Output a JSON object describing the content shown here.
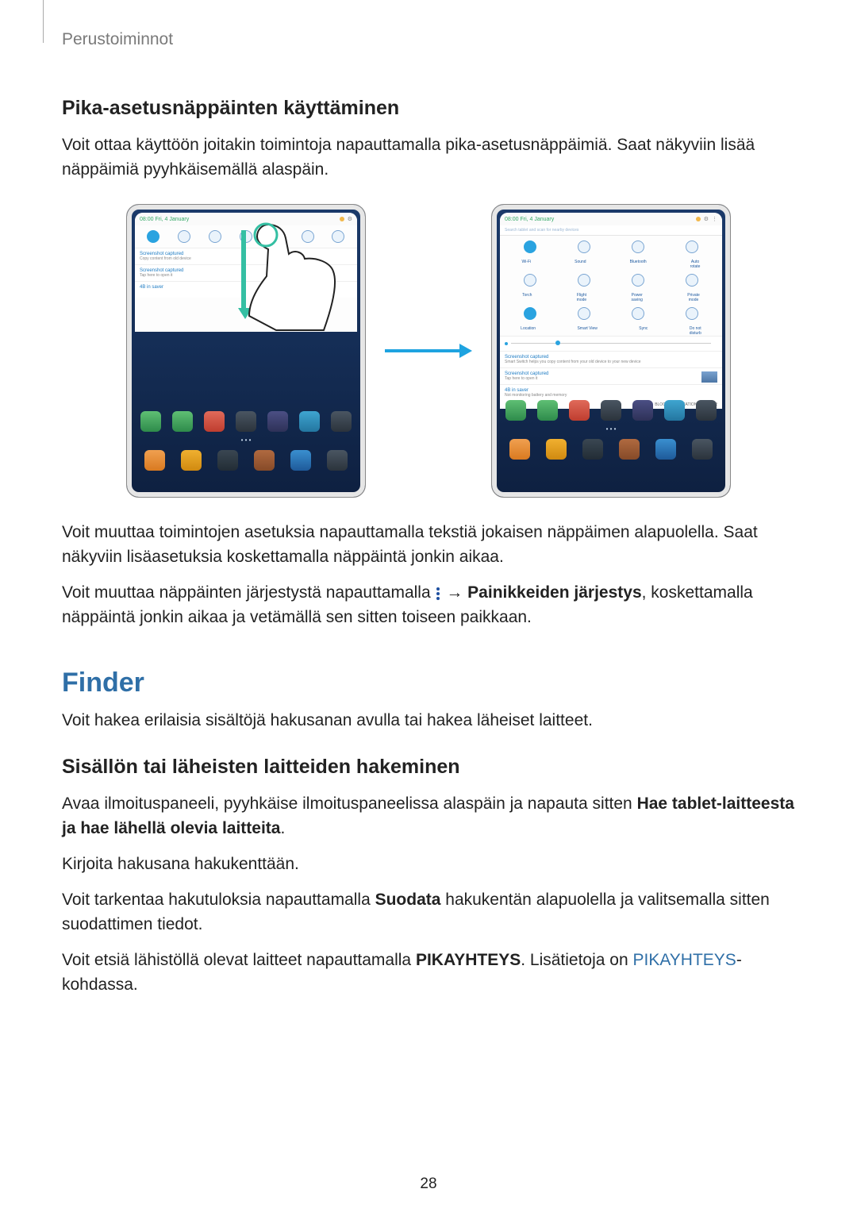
{
  "header": "Perustoiminnot",
  "page_number": "28",
  "h3_quick": "Pika-asetusnäppäinten käyttäminen",
  "p_quick_intro": "Voit ottaa käyttöön joitakin toimintoja napauttamalla pika-asetusnäppäimiä. Saat näkyviin lisää näppäimiä pyyhkäisemällä alaspäin.",
  "p_quick_settings": "Voit muuttaa toimintojen asetuksia napauttamalla tekstiä jokaisen näppäimen alapuolella. Saat näkyviin lisäasetuksia koskettamalla näppäintä jonkin aikaa.",
  "reorder_pre": "Voit muuttaa näppäinten järjestystä napauttamalla ",
  "reorder_arrow": "→ ",
  "reorder_bold": "Painikkeiden järjestys",
  "reorder_post": ", koskettamalla näppäintä jonkin aikaa ja vetämällä sen sitten toiseen paikkaan.",
  "h2_finder": "Finder",
  "p_finder_intro": "Voit hakea erilaisia sisältöjä hakusanan avulla tai hakea läheiset laitteet.",
  "h3_search": "Sisällön tai läheisten laitteiden hakeminen",
  "search_steps": {
    "open_pre": "Avaa ilmoituspaneeli, pyyhkäise ilmoituspaneelissa alaspäin ja napauta sitten ",
    "open_bold": "Hae tablet-laitteesta ja hae lähellä olevia laitteita",
    "open_post": ".",
    "type": "Kirjoita hakusana hakukenttään.",
    "filter_pre": "Voit tarkentaa hakutuloksia napauttamalla ",
    "filter_bold": "Suodata",
    "filter_post": " hakukentän alapuolella ja valitsemalla sitten suodattimen tiedot.",
    "quick_pre": "Voit etsiä lähistöllä olevat laitteet napauttamalla ",
    "quick_bold": "PIKAYHTEYS",
    "quick_mid": ". Lisätietoja on ",
    "quick_link": "PIKAYHTEYS",
    "quick_post": "-kohdassa."
  }
}
